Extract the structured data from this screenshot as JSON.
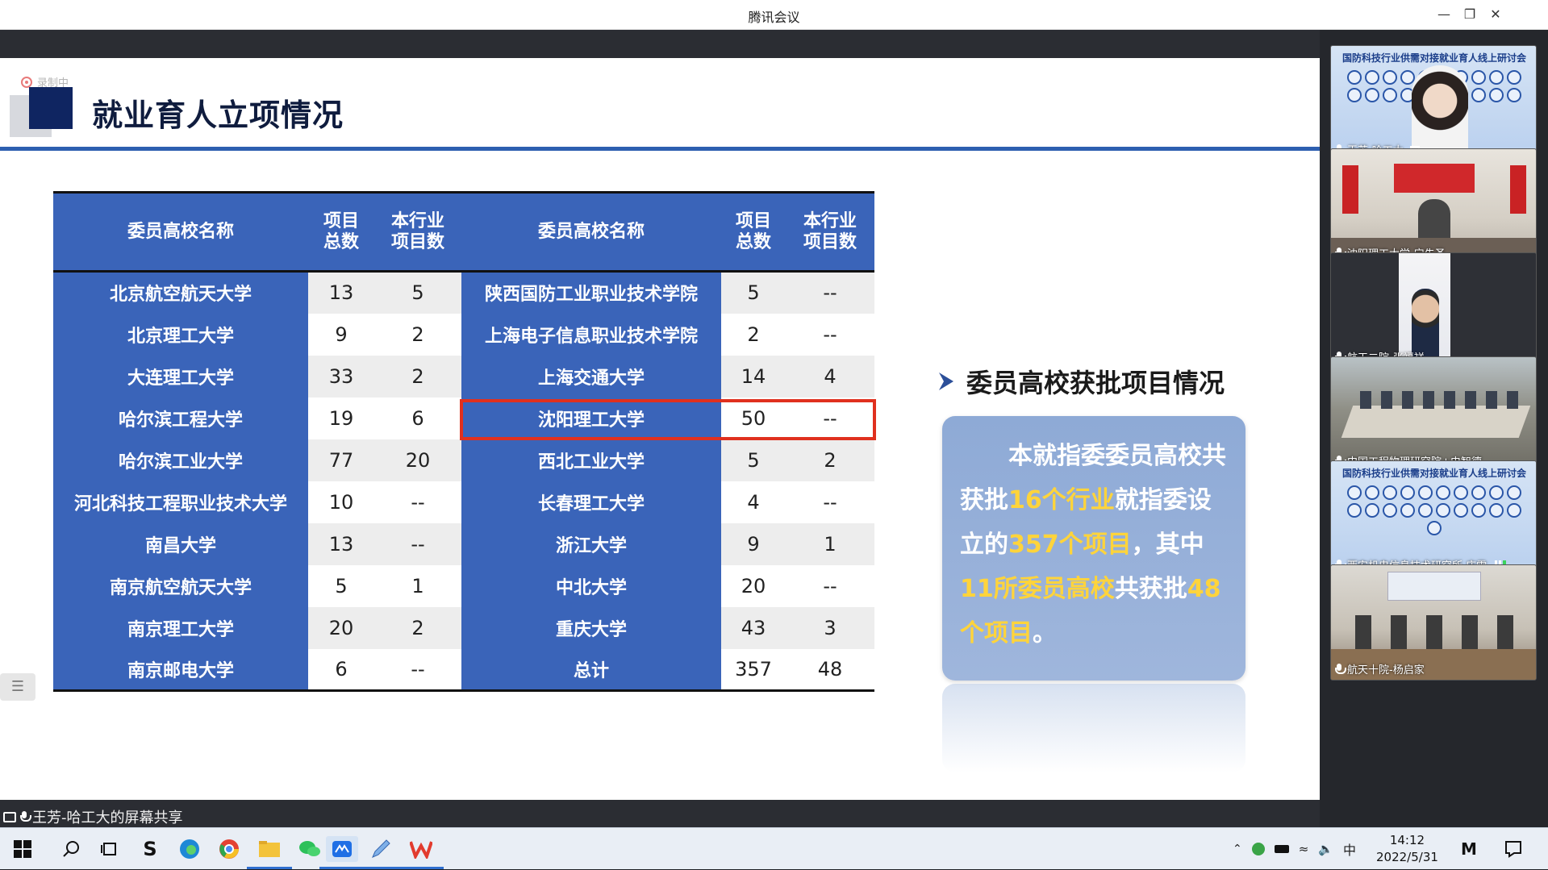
{
  "window": {
    "title": "腾讯会议"
  },
  "recording": {
    "label": "录制中"
  },
  "slide": {
    "title": "就业育人立项情况",
    "table": {
      "headers": [
        "委员高校名称",
        "项目\n总数",
        "本行业\n项目数",
        "委员高校名称",
        "项目\n总数",
        "本行业\n项目数"
      ],
      "rows": [
        [
          "北京航空航天大学",
          "13",
          "5",
          "陕西国防工业职业技术学院",
          "5",
          "--"
        ],
        [
          "北京理工大学",
          "9",
          "2",
          "上海电子信息职业技术学院",
          "2",
          "--"
        ],
        [
          "大连理工大学",
          "33",
          "2",
          "上海交通大学",
          "14",
          "4"
        ],
        [
          "哈尔滨工程大学",
          "19",
          "6",
          "沈阳理工大学",
          "50",
          "--"
        ],
        [
          "哈尔滨工业大学",
          "77",
          "20",
          "西北工业大学",
          "5",
          "2"
        ],
        [
          "河北科技工程职业技术大学",
          "10",
          "--",
          "长春理工大学",
          "4",
          "--"
        ],
        [
          "南昌大学",
          "13",
          "--",
          "浙江大学",
          "9",
          "1"
        ],
        [
          "南京航空航天大学",
          "5",
          "1",
          "中北大学",
          "20",
          "--"
        ],
        [
          "南京理工大学",
          "20",
          "2",
          "重庆大学",
          "43",
          "3"
        ],
        [
          "南京邮电大学",
          "6",
          "--",
          "总计",
          "357",
          "48"
        ]
      ]
    },
    "bullet_title": "委员高校获批项目情况",
    "summary": {
      "p1": "本就指委委员高校共获批",
      "h1": "16个行业",
      "p2": "就指委设立的",
      "h2": "357个项目",
      "p3": "，其中",
      "h3": "11所委员高校",
      "p4": "共获批",
      "h4": "48个项目",
      "p5": "。"
    }
  },
  "share": {
    "label": "王芳-哈工大的屏幕共享"
  },
  "participants": [
    {
      "name": "王芳-哈工大",
      "kind": "banner"
    },
    {
      "name": "沈阳理工大学-宁先圣",
      "kind": "room"
    },
    {
      "name": "航天二院-张福祥",
      "kind": "person"
    },
    {
      "name": "中国工程物理研究院+史智德",
      "kind": "meeting"
    },
    {
      "name": "西安机电信息技术研究所 庄雷",
      "kind": "banner"
    },
    {
      "name": "航天十院-杨启家",
      "kind": "room2"
    }
  ],
  "banner_title": "国防科技行业供需对接就业育人线上研讨会",
  "tray": {
    "ime": "中"
  },
  "clock": {
    "time": "14:12",
    "date": "2022/5/31"
  },
  "colors": {
    "header_blue": "#3a64b9",
    "highlight_red": "#e0301e",
    "accent_yellow": "#ffd43b",
    "title_navy": "#0f1c3e"
  }
}
